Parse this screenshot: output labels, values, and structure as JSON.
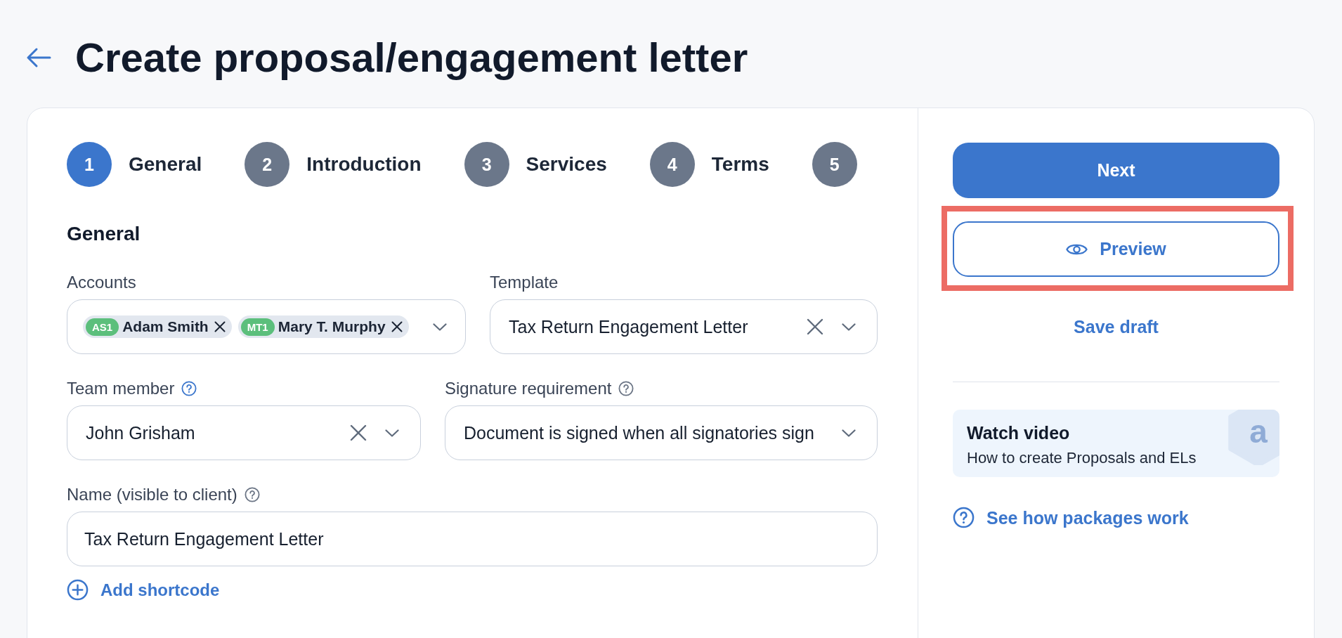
{
  "header": {
    "title": "Create proposal/engagement letter"
  },
  "steps": [
    {
      "number": "1",
      "label": "General",
      "selected": true
    },
    {
      "number": "2",
      "label": "Introduction",
      "selected": false
    },
    {
      "number": "3",
      "label": "Services",
      "selected": false
    },
    {
      "number": "4",
      "label": "Terms",
      "selected": false
    },
    {
      "number": "5",
      "selected": false
    }
  ],
  "form": {
    "heading": "General",
    "rows": [
      {
        "fields": [
          {
            "kind": "multiselect",
            "label": "Accounts",
            "chips": [
              {
                "initials": "AS1",
                "name": "Adam Smith"
              },
              {
                "initials": "MT1",
                "name": "Mary T. Murphy"
              }
            ]
          },
          {
            "kind": "select",
            "label": "Template",
            "value": "Tax Return Engagement Letter",
            "clearable": true
          }
        ]
      },
      {
        "fields": [
          {
            "kind": "select",
            "label": "Team member",
            "help": {
              "active": true
            },
            "value": "John Grisham",
            "clearable": true
          },
          {
            "kind": "select",
            "label": "Signature requirement",
            "help": {
              "active": false
            },
            "value": "Document is signed when all signatories sign",
            "clearable": false
          }
        ]
      },
      {
        "fields": [
          {
            "kind": "text",
            "label": "Name (visible to client)",
            "help": {
              "active": false
            },
            "value": "Tax Return Engagement Letter"
          }
        ]
      }
    ],
    "add_link": "Add shortcode"
  },
  "actions": [
    {
      "kind": "primary",
      "label": "Next",
      "highlighted": false
    },
    {
      "kind": "outline",
      "label": "Preview",
      "highlighted": true
    },
    {
      "kind": "link",
      "label": "Save draft",
      "highlighted": false
    }
  ],
  "video_card": {
    "title": "Watch video",
    "subtitle": "How to create Proposals and ELs",
    "logo": "a"
  },
  "help_link": "See how packages work"
}
